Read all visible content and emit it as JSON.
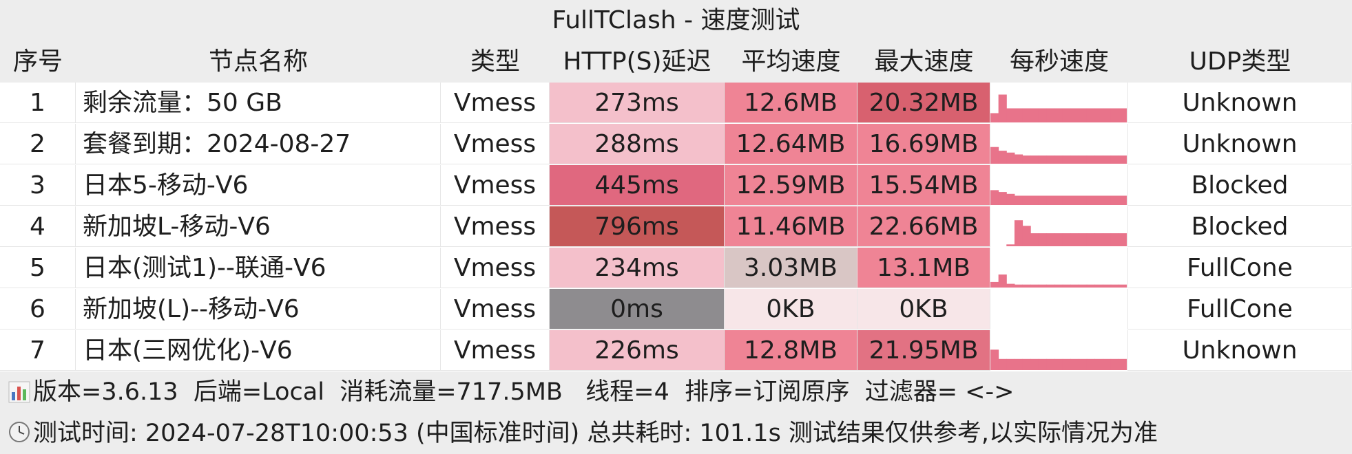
{
  "title": "FullTClash - 速度测试",
  "headers": [
    "序号",
    "节点名称",
    "类型",
    "HTTP(S)延迟",
    "平均速度",
    "最大速度",
    "每秒速度",
    "UDP类型"
  ],
  "rows": [
    {
      "idx": "1",
      "name": "剩余流量：50 GB",
      "type": "Vmess",
      "delay": "273ms",
      "avg": "12.6MB",
      "max": "20.32MB",
      "udp": "Unknown",
      "speed_per_sec": [
        0.25,
        0.75,
        0.38,
        0.38,
        0.38,
        0.38,
        0.38,
        0.38,
        0.38,
        0.38,
        0.38,
        0.38,
        0.38,
        0.38,
        0.38,
        0.38,
        0.38
      ]
    },
    {
      "idx": "2",
      "name": "套餐到期：2024-08-27",
      "type": "Vmess",
      "delay": "288ms",
      "avg": "12.64MB",
      "max": "16.69MB",
      "udp": "Unknown",
      "speed_per_sec": [
        0.45,
        0.35,
        0.3,
        0.25,
        0.22,
        0.22,
        0.22,
        0.22,
        0.22,
        0.22,
        0.22,
        0.22,
        0.22,
        0.22,
        0.22,
        0.22,
        0.22
      ]
    },
    {
      "idx": "3",
      "name": "日本5-移动-V6",
      "type": "Vmess",
      "delay": "445ms",
      "avg": "12.59MB",
      "max": "15.54MB",
      "udp": "Blocked",
      "speed_per_sec": [
        0.4,
        0.35,
        0.3,
        0.25,
        0.25,
        0.25,
        0.25,
        0.25,
        0.25,
        0.25,
        0.25,
        0.25,
        0.25,
        0.25,
        0.25,
        0.25,
        0.25
      ]
    },
    {
      "idx": "4",
      "name": "新加坡L-移动-V6",
      "type": "Vmess",
      "delay": "796ms",
      "avg": "11.46MB",
      "max": "22.66MB",
      "udp": "Blocked",
      "speed_per_sec": [
        0,
        0,
        0.05,
        0.7,
        0.55,
        0.35,
        0.35,
        0.35,
        0.35,
        0.35,
        0.35,
        0.35,
        0.35,
        0.35,
        0.35,
        0.35,
        0.35
      ]
    },
    {
      "idx": "5",
      "name": "日本(测试1)--联通-V6",
      "type": "Vmess",
      "delay": "234ms",
      "avg": "3.03MB",
      "max": "13.1MB",
      "udp": "FullCone",
      "speed_per_sec": [
        0.15,
        0.35,
        0.1,
        0.08,
        0.08,
        0.08,
        0.08,
        0.08,
        0.08,
        0.08,
        0.08,
        0.08,
        0.08,
        0.08,
        0.08,
        0.08,
        0.08
      ]
    },
    {
      "idx": "6",
      "name": "新加坡(L)--移动-V6",
      "type": "Vmess",
      "delay": "0ms",
      "avg": "0KB",
      "max": "0KB",
      "udp": "FullCone",
      "speed_per_sec": []
    },
    {
      "idx": "7",
      "name": "日本(三网优化)-V6",
      "type": "Vmess",
      "delay": "226ms",
      "avg": "12.8MB",
      "max": "21.95MB",
      "udp": "Unknown",
      "speed_per_sec": [
        0.55,
        0.3,
        0.3,
        0.3,
        0.3,
        0.3,
        0.3,
        0.3,
        0.3,
        0.3,
        0.3,
        0.3,
        0.3,
        0.3,
        0.3,
        0.3,
        0.3
      ]
    }
  ],
  "cell_colors": {
    "delay": [
      "#f4c0cb",
      "#f4c0cb",
      "#e0687f",
      "#c55858",
      "#f4c0cb",
      "#8e8c8f",
      "#f4c0cb"
    ],
    "avg": [
      "#ef8495",
      "#ef8495",
      "#ef8495",
      "#ef8495",
      "#d9c6c5",
      "#f7e6e8",
      "#ef8495"
    ],
    "max": [
      "#d8616f",
      "#ef8495",
      "#ef8495",
      "#ef8495",
      "#ef8495",
      "#f7e6e8",
      "#e27283"
    ]
  },
  "footer": {
    "line1": "版本=3.6.13  后端=Local  消耗流量=717.5MB   线程=4  排序=订阅原序  过滤器= <->",
    "line2": "测试时间: 2024-07-28T10:00:53 (中国标准时间) 总共耗时: 101.1s 测试结果仅供参考,以实际情况为准",
    "icon1": "bar-chart-icon",
    "icon2": "clock-icon"
  }
}
